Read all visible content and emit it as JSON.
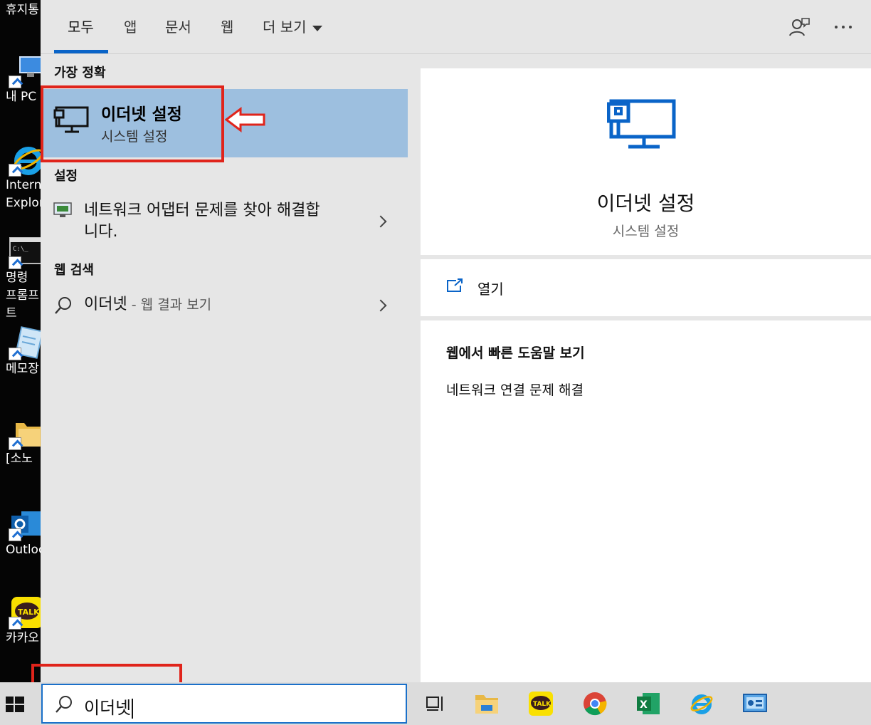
{
  "desktop": {
    "icons": [
      {
        "label": "휴지통",
        "icon": "recycle-bin-icon"
      },
      {
        "label": "내 PC",
        "icon": "this-pc-icon"
      },
      {
        "label": "Internet Explorer",
        "icon": "internet-explorer-icon"
      },
      {
        "label": "명령 프롬프트",
        "icon": "command-prompt-icon"
      },
      {
        "label": "메모장",
        "icon": "notepad-icon"
      },
      {
        "label": "[소노",
        "icon": "folder-icon"
      },
      {
        "label": "Outlook",
        "icon": "outlook-icon"
      },
      {
        "label": "카카오",
        "icon": "kakaotalk-icon"
      }
    ]
  },
  "tabs": {
    "items": [
      "모두",
      "앱",
      "문서",
      "웹"
    ],
    "more": "더 보기",
    "active": "모두"
  },
  "results": {
    "best_match_title": "가장 정확",
    "best": {
      "title": "이더넷 설정",
      "subtitle": "시스템 설정",
      "icon": "ethernet-monitor-icon"
    },
    "settings_title": "설정",
    "settings_item": {
      "line1": "네트워크 어댑터 문제를 찾아 해결합",
      "line2": "니다.",
      "icon": "network-troubleshoot-icon"
    },
    "web_title": "웹 검색",
    "web_item": {
      "query": "이더넷",
      "suffix": " - 웹 결과 보기",
      "icon": "search-icon"
    }
  },
  "preview": {
    "title": "이더넷 설정",
    "subtitle": "시스템 설정",
    "open_label": "열기",
    "help_title": "웹에서 빠른 도움말 보기",
    "help_link": "네트워크 연결 문제 해결"
  },
  "taskbar": {
    "search_value": "이더넷",
    "apps": [
      "task-view-icon",
      "file-explorer-icon",
      "kakaotalk-icon",
      "chrome-icon",
      "excel-icon",
      "internet-explorer-icon",
      "control-panel-icon"
    ]
  },
  "colors": {
    "accent": "#0a64c8",
    "selection": "#9dbfdf",
    "panel": "#e6e6e6",
    "annotation": "#e0241b"
  }
}
